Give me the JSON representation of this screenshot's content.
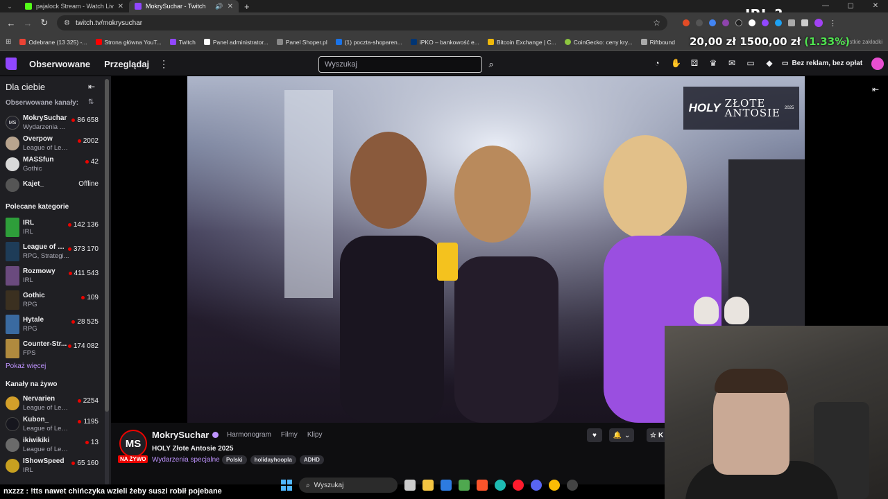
{
  "browser": {
    "tabs": [
      {
        "title": "pajalock Stream - Watch Live on",
        "favicon_color": "#53fc18",
        "active": false
      },
      {
        "title": "MokrySuchar - Twitch",
        "favicon_color": "#9147ff",
        "active": true
      }
    ],
    "url": "twitch.tv/mokrysuchar",
    "bookmarks": [
      {
        "label": "Odebrane (13 325) -...",
        "color": "#ea4335"
      },
      {
        "label": "Strona główna YouT...",
        "color": "#ff0000"
      },
      {
        "label": "Twitch",
        "color": "#9147ff"
      },
      {
        "label": "Panel administrator...",
        "color": "#ffffff"
      },
      {
        "label": "Panel Shoper.pl",
        "color": "#888888"
      },
      {
        "label": "(1) poczta-shoparen...",
        "color": "#1a73e8"
      },
      {
        "label": "iPKO – bankowość e...",
        "color": "#003574"
      },
      {
        "label": "Bitcoin Exchange | C...",
        "color": "#f0b90b"
      },
      {
        "label": "CoinGecko: ceny kry...",
        "color": "#8dc63f"
      },
      {
        "label": "Riftbound",
        "color": "#aaaaaa"
      }
    ],
    "all_bookmarks": "Wszystkie zakładki",
    "overlay_irl": "IRL ?",
    "overlay_price_a": "20,00 zł",
    "overlay_price_b": "1500,00 zł",
    "overlay_pct": "(1.33%)"
  },
  "nav": {
    "following": "Obserwowane",
    "browse": "Przeglądaj",
    "search_placeholder": "Wyszukaj",
    "turbo": "Bez reklam, bez opłat"
  },
  "sidebar": {
    "header": "Dla ciebie",
    "followed_title": "Obserwowane kanały:",
    "followed": [
      {
        "name": "MokrySuchar",
        "sub": "Wydarzenia ...",
        "count": "86 658",
        "live": true,
        "color": "#22222a"
      },
      {
        "name": "Overpow",
        "sub": "League of Leg...",
        "count": "2002",
        "live": true,
        "color": "#b8a48e"
      },
      {
        "name": "MASSfun",
        "sub": "Gothic",
        "count": "42",
        "live": true,
        "color": "#d9d9d9"
      },
      {
        "name": "Kajet_",
        "sub": "",
        "count": "Offline",
        "live": false,
        "color": "#555555"
      }
    ],
    "recommended_title": "Polecane kategorie",
    "categories": [
      {
        "name": "IRL",
        "sub": "IRL",
        "count": "142 136",
        "color": "#2e9e3a"
      },
      {
        "name": "League of L...",
        "sub": "RPG, Strategi...",
        "count": "373 170",
        "color": "#1e3c58"
      },
      {
        "name": "Rozmowy",
        "sub": "IRL",
        "count": "411 543",
        "color": "#6a4a7e"
      },
      {
        "name": "Gothic",
        "sub": "RPG",
        "count": "109",
        "color": "#3b3020"
      },
      {
        "name": "Hytale",
        "sub": "RPG",
        "count": "28 525",
        "color": "#3a6aa0"
      },
      {
        "name": "Counter-Str...",
        "sub": "FPS",
        "count": "174 082",
        "color": "#b08a3e"
      }
    ],
    "show_more": "Pokaż więcej",
    "live_title": "Kanały na żywo",
    "live_channels": [
      {
        "name": "Nervarien",
        "sub": "League of Leg...",
        "count": "2254",
        "color": "#d4a02a"
      },
      {
        "name": "Kubon_",
        "sub": "League of Leg...",
        "count": "1195",
        "color": "#16161e"
      },
      {
        "name": "ikiwikiki",
        "sub": "League of Lege...",
        "count": "13",
        "color": "#6a6a6a"
      },
      {
        "name": "IShowSpeed",
        "sub": "IRL",
        "count": "65 160",
        "color": "#c8a020"
      }
    ]
  },
  "video": {
    "overlay_brand": "HOLY",
    "overlay_line1": "ZŁOTE",
    "overlay_line2": "ANTOSIE",
    "overlay_year": "2025"
  },
  "channel": {
    "avatar_text": "MS",
    "name": "MokrySuchar",
    "live_badge": "NA ŻYWO",
    "tabs": [
      "Harmonogram",
      "Filmy",
      "Klipy"
    ],
    "title": "HOLY Złote Antosie 2025",
    "category": "Wydarzenia specjalne",
    "tags": [
      "Polski",
      "holidayhoopla",
      "ADHD"
    ],
    "sub_label": "K"
  },
  "chat": {
    "message": "nxzzz : !tts nawet chińczyka wzieli żeby suszi robił pojebane"
  },
  "taskbar": {
    "search": "Wyszukaj"
  }
}
